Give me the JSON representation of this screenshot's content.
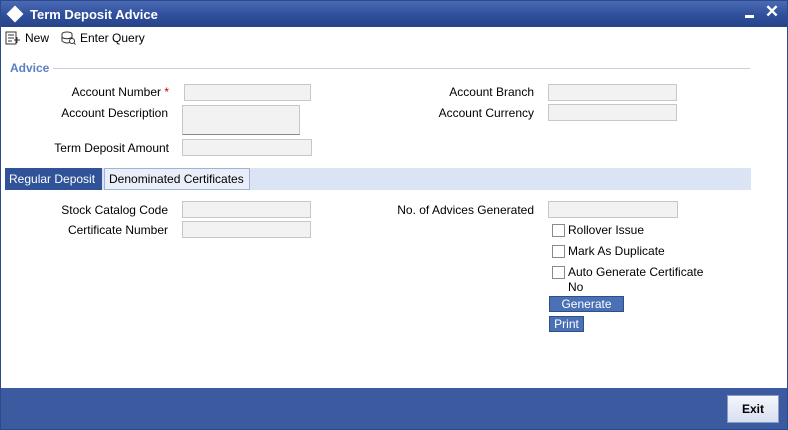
{
  "window": {
    "title": "Term Deposit Advice"
  },
  "toolbar": {
    "new_label": "New",
    "enter_query_label": "Enter Query"
  },
  "advice": {
    "section_title": "Advice",
    "account_number_label": "Account Number",
    "required_mark": "*",
    "account_description_label": "Account Description",
    "term_deposit_amount_label": "Term Deposit Amount",
    "account_branch_label": "Account Branch",
    "account_currency_label": "Account Currency",
    "account_number_value": "",
    "account_description_value": "",
    "term_deposit_amount_value": "",
    "account_branch_value": "",
    "account_currency_value": ""
  },
  "tabs": [
    {
      "label": "Regular Deposit",
      "active": true
    },
    {
      "label": "Denominated Certificates",
      "active": false
    }
  ],
  "regular": {
    "stock_catalog_code_label": "Stock Catalog Code",
    "certificate_number_label": "Certificate Number",
    "advices_generated_label": "No. of Advices Generated",
    "stock_catalog_code_value": "",
    "certificate_number_value": "",
    "advices_generated_value": "",
    "rollover_issue_label": "Rollover Issue",
    "rollover_issue_checked": false,
    "mark_duplicate_label": "Mark As Duplicate",
    "mark_duplicate_checked": false,
    "auto_generate_label_line1": "Auto Generate Certificate",
    "auto_generate_label_line2": "No",
    "auto_generate_checked": false,
    "generate_label": "Generate",
    "print_label": "Print"
  },
  "footer": {
    "exit_label": "Exit"
  },
  "colors": {
    "titlebar": "#2f4f9c",
    "footer": "#3c5aa0",
    "section_title": "#5a7fc2",
    "active_tab": "#2f5298"
  }
}
